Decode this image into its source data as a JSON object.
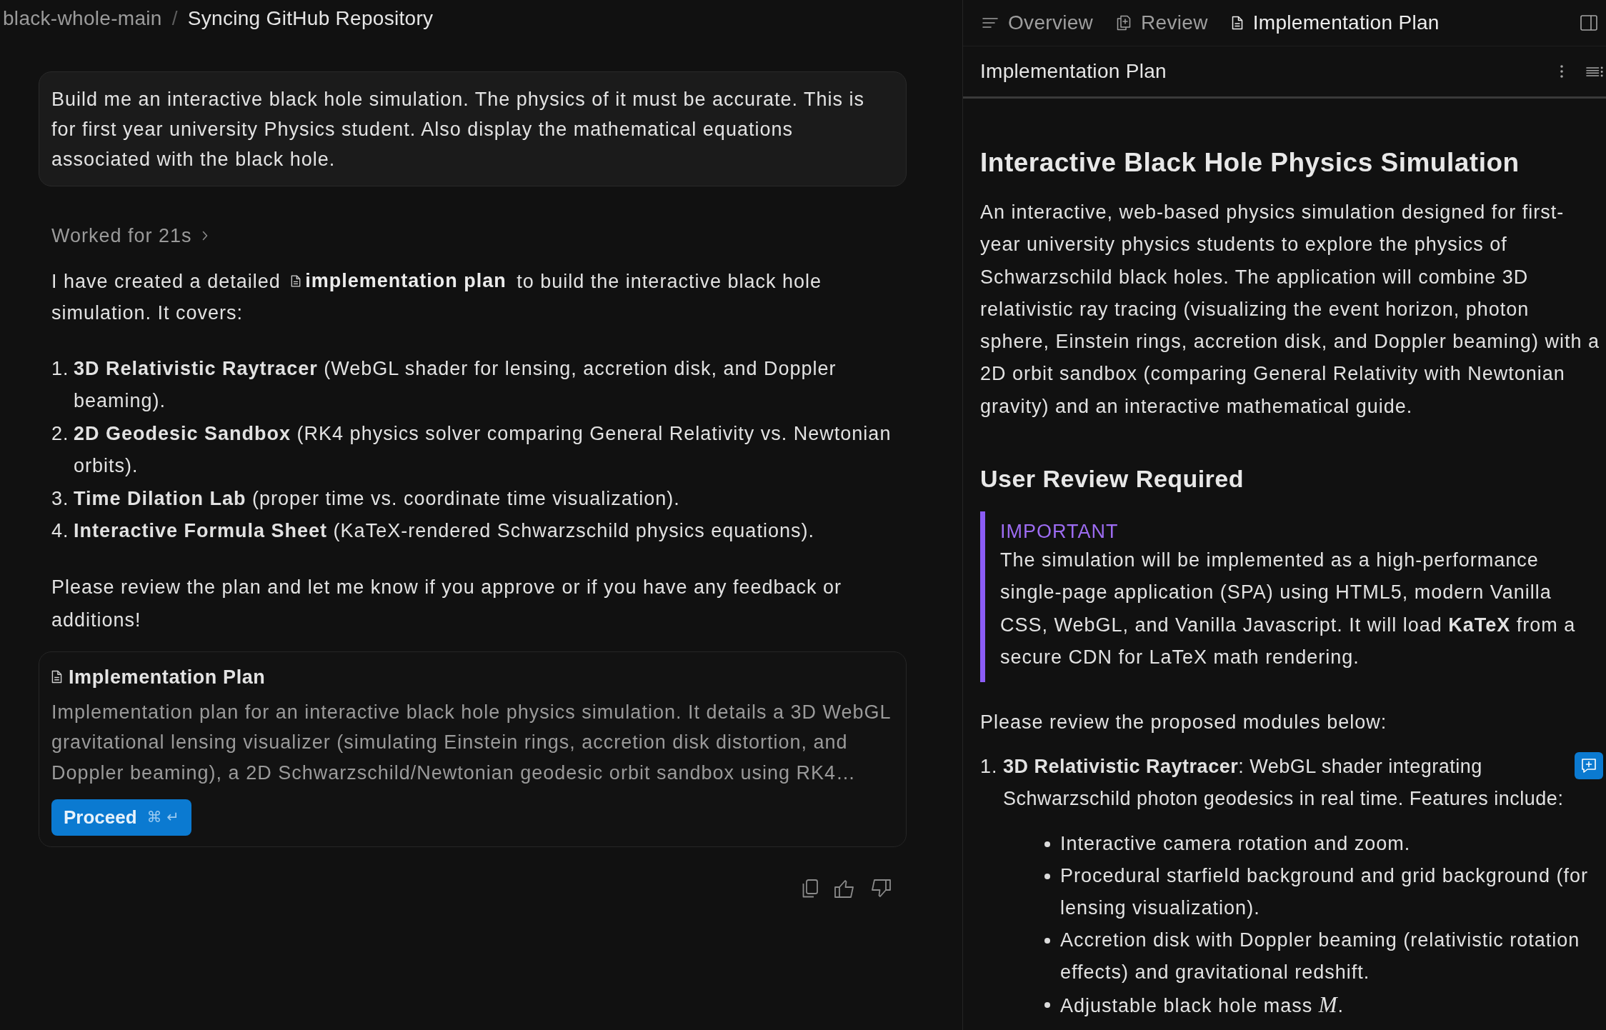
{
  "breadcrumb": {
    "project": "black-whole-main",
    "separator": "/",
    "title": "Syncing GitHub Repository"
  },
  "chat": {
    "user_message": "Build me an interactive black hole simulation. The physics of it must be accurate. This is for first year university Physics student. Also display the mathematical equations associated with the black hole.",
    "worked_for": {
      "label": "Worked for 21s",
      "expanded": false
    },
    "summary": {
      "before": "I have created a detailed",
      "link": "implementation plan",
      "after": "to build the interactive black hole simulation. It covers:"
    },
    "modules": [
      {
        "number": "1.",
        "text": "**3D Relativistic Raytracer** (WebGL shader for lensing, accretion disk, and Doppler beaming)."
      },
      {
        "number": "2.",
        "text": "**2D Geodesic Sandbox** (RK4 physics solver comparing General Relativity vs. Newtonian orbits)."
      },
      {
        "number": "3.",
        "text": "**Time Dilation Lab** (proper time vs. coordinate time visualization)."
      },
      {
        "number": "4.",
        "text": "**Interactive Formula Sheet** (KaTeX-rendered Schwarzschild physics equations)."
      }
    ],
    "closing": "Please review the plan and let me know if you approve or if you have any feedback or additions!",
    "artifact_card": {
      "title": "Implementation Plan",
      "description": "Implementation plan for an interactive black hole physics simulation. It details a 3D WebGL gravitational lensing visualizer (simulating Einstein rings, accretion disk distortion, and Doppler beaming), a 2D Schwarzschild/Newtonian geodesic orbit sandbox using RK4…",
      "button": {
        "label": "Proceed",
        "shortcut": "⌘ ↵"
      }
    }
  },
  "plan_panel": {
    "tabs": [
      {
        "label": "Overview",
        "kind": "outline",
        "selected": false
      },
      {
        "label": "Review",
        "kind": "review",
        "selected": false
      },
      {
        "label": "Implementation Plan",
        "kind": "document",
        "selected": true
      }
    ],
    "document_title": "Implementation Plan",
    "heading": "Interactive Black Hole Physics Simulation",
    "intro": "An interactive, web-based physics simulation designed for first-year university physics students to explore the physics of Schwarzschild black holes. The application will combine 3D relativistic ray tracing (visualizing the event horizon, photon sphere, Einstein rings, accretion disk, and Doppler beaming) with a 2D orbit sandbox (comparing General Relativity with Newtonian gravity) and an interactive mathematical guide.",
    "section_heading": "User Review Required",
    "callout": {
      "label": "IMPORTANT",
      "text": "The simulation will be implemented as a high-performance single-page application (SPA) using HTML5, modern Vanilla CSS, WebGL, and Vanilla Javascript. It will load **KaTeX** from a secure CDN for LaTeX math rendering."
    },
    "review_prompt": "Please review the proposed modules below:",
    "modules": [
      {
        "number": "1.",
        "text": "**3D Relativistic Raytracer**: WebGL shader integrating Schwarzschild photon geodesics in real time. Features include:",
        "features": [
          "Interactive camera rotation and zoom.",
          "Procedural starfield background and grid background (for lensing visualization).",
          "Accretion disk with Doppler beaming (relativistic rotation effects) and gravitational redshift.",
          "Adjustable black hole mass *M*."
        ]
      }
    ]
  }
}
